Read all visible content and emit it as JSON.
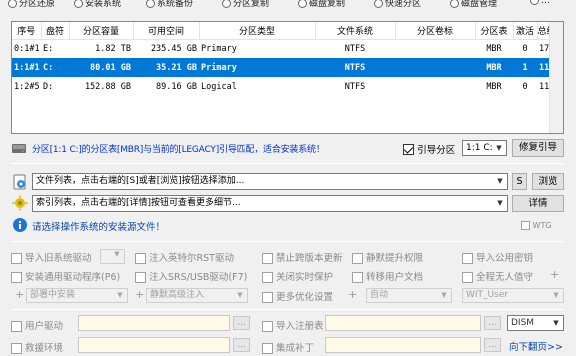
{
  "top_options": [
    {
      "label": "分区还原"
    },
    {
      "label": "安装系统"
    },
    {
      "label": "系统备份"
    },
    {
      "label": "分区复制"
    },
    {
      "label": "磁盘复制"
    },
    {
      "label": "快速分区"
    },
    {
      "label": "磁盘管理"
    },
    {
      "label": "…"
    }
  ],
  "partition_table": {
    "columns": [
      "序号",
      "盘符",
      "分区容量",
      "可用空间",
      "分区类型",
      "文件系统",
      "分区卷标",
      "分区表",
      "激活",
      "总线"
    ],
    "rows": [
      {
        "index": "0:1#1",
        "drive": "E:",
        "capacity": "1.82 TB",
        "free": "235.45 GB",
        "type": "Primary",
        "fs": "NTFS",
        "label": "",
        "table": "MBR",
        "active": "0",
        "bus": "17",
        "selected": false
      },
      {
        "index": "1:1#1",
        "drive": "C:",
        "capacity": "80.01 GB",
        "free": "35.21 GB",
        "type": "Primary",
        "fs": "NTFS",
        "label": "",
        "table": "MBR",
        "active": "1",
        "bus": "11",
        "selected": true
      },
      {
        "index": "1:2#5",
        "drive": "D:",
        "capacity": "152.88 GB",
        "free": "89.16 GB",
        "type": "Logical",
        "fs": "NTFS",
        "label": "",
        "table": "MBR",
        "active": "0",
        "bus": "11",
        "selected": false
      }
    ]
  },
  "status": {
    "message": "分区[1:1 C:]的分区表[MBR]与当前的[LEGACY]引导匹配，适合安装系统！",
    "boot_partition_label": "引导分区",
    "boot_partition_checked": true,
    "boot_partition_value": "1:1 C:",
    "repair_boot_button": "修复引导"
  },
  "source": {
    "file_list_placeholder": "文件列表，点击右端的[S]或者[浏览]按钮选择添加...",
    "s_button": "S",
    "browse_button": "浏览",
    "index_list_placeholder": "索引列表，点击右端的[详情]按钮可查看更多细节...",
    "details_button": "详情",
    "hint": "请选择操作系统的安装源文件！",
    "wtg_label": "WTG"
  },
  "options": {
    "import_old_driver": "导入旧系统驱动",
    "install_generic_driver": "安装通用驱动程序(P6)",
    "deploy_install": "部署中安装",
    "inject_intel_rst": "注入英特尔RST驱动",
    "inject_usb": "注入SRS/USB驱动(F7)",
    "silent_inject": "静默高级注入",
    "disable_old_update": "禁止跨版本更新",
    "disable_realtime": "关闭实时保护",
    "more_optimize": "更多优化设置",
    "silent_elevate": "静默提升权限",
    "migrate_user_docs": "转移用户文档",
    "auto_label": "自动",
    "import_public_key": "导入公用密钥",
    "unattended": "全程无人值守",
    "user_name": "WIT_User",
    "user_driver": "用户驱动",
    "import_registry": "导入注册表",
    "dism": "DISM",
    "migrate_env": "救援环境",
    "integrate_patch": "集成补丁",
    "next_page": "向下翻页>>",
    "ellipsis": "..."
  },
  "colors": {
    "selection": "#0078d7",
    "status_text": "#0033cc",
    "link_blue": "#0645ad",
    "input_bg": "#fffbe8"
  }
}
